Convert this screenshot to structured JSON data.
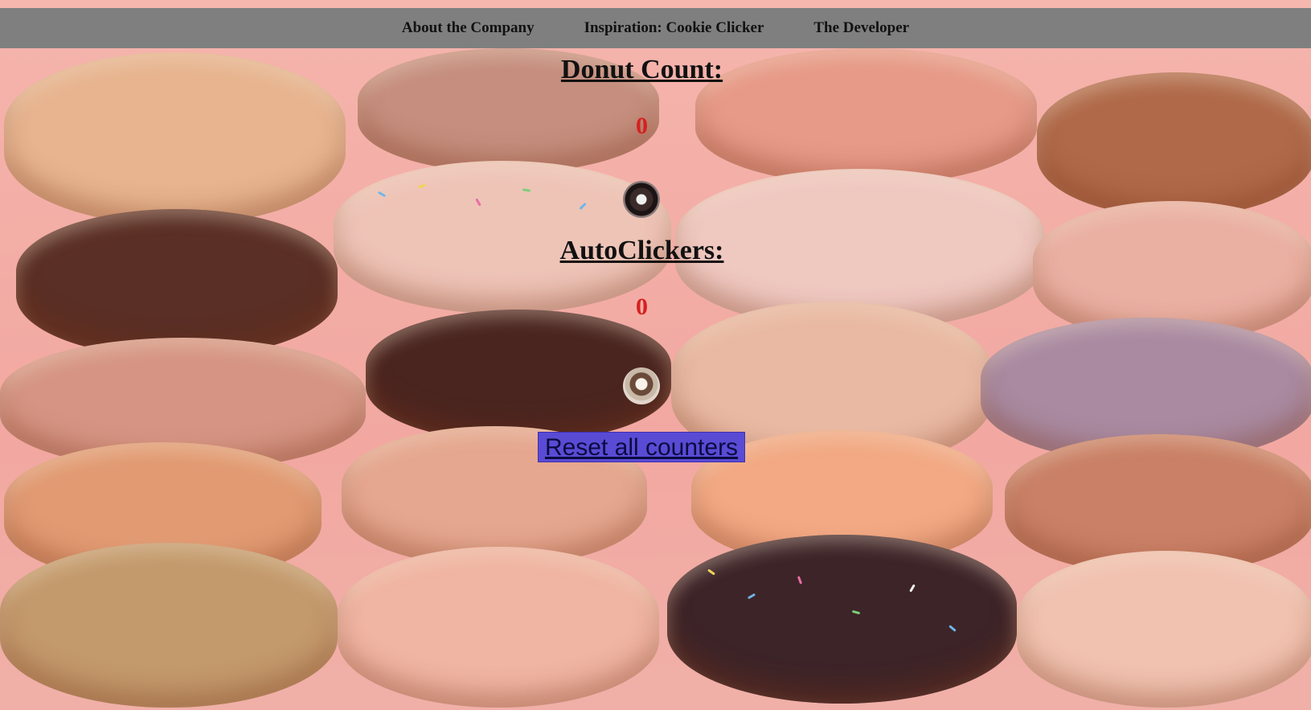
{
  "nav": {
    "items": [
      {
        "label": "About the Company"
      },
      {
        "label": "Inspiration: Cookie Clicker"
      },
      {
        "label": "The Developer"
      }
    ]
  },
  "donut_section": {
    "title": "Donut Count:",
    "count": "0",
    "icon": "donut-icon"
  },
  "auto_section": {
    "title": "AutoClickers:",
    "count": "0",
    "icon": "autoclicker-donut-icon"
  },
  "reset": {
    "label": "Reset all counters"
  },
  "colors": {
    "nav_bg": "#7f7f7f",
    "counter": "#d62020",
    "reset_bg": "#5a4bd4",
    "page_bg": "#f6c1bb"
  }
}
